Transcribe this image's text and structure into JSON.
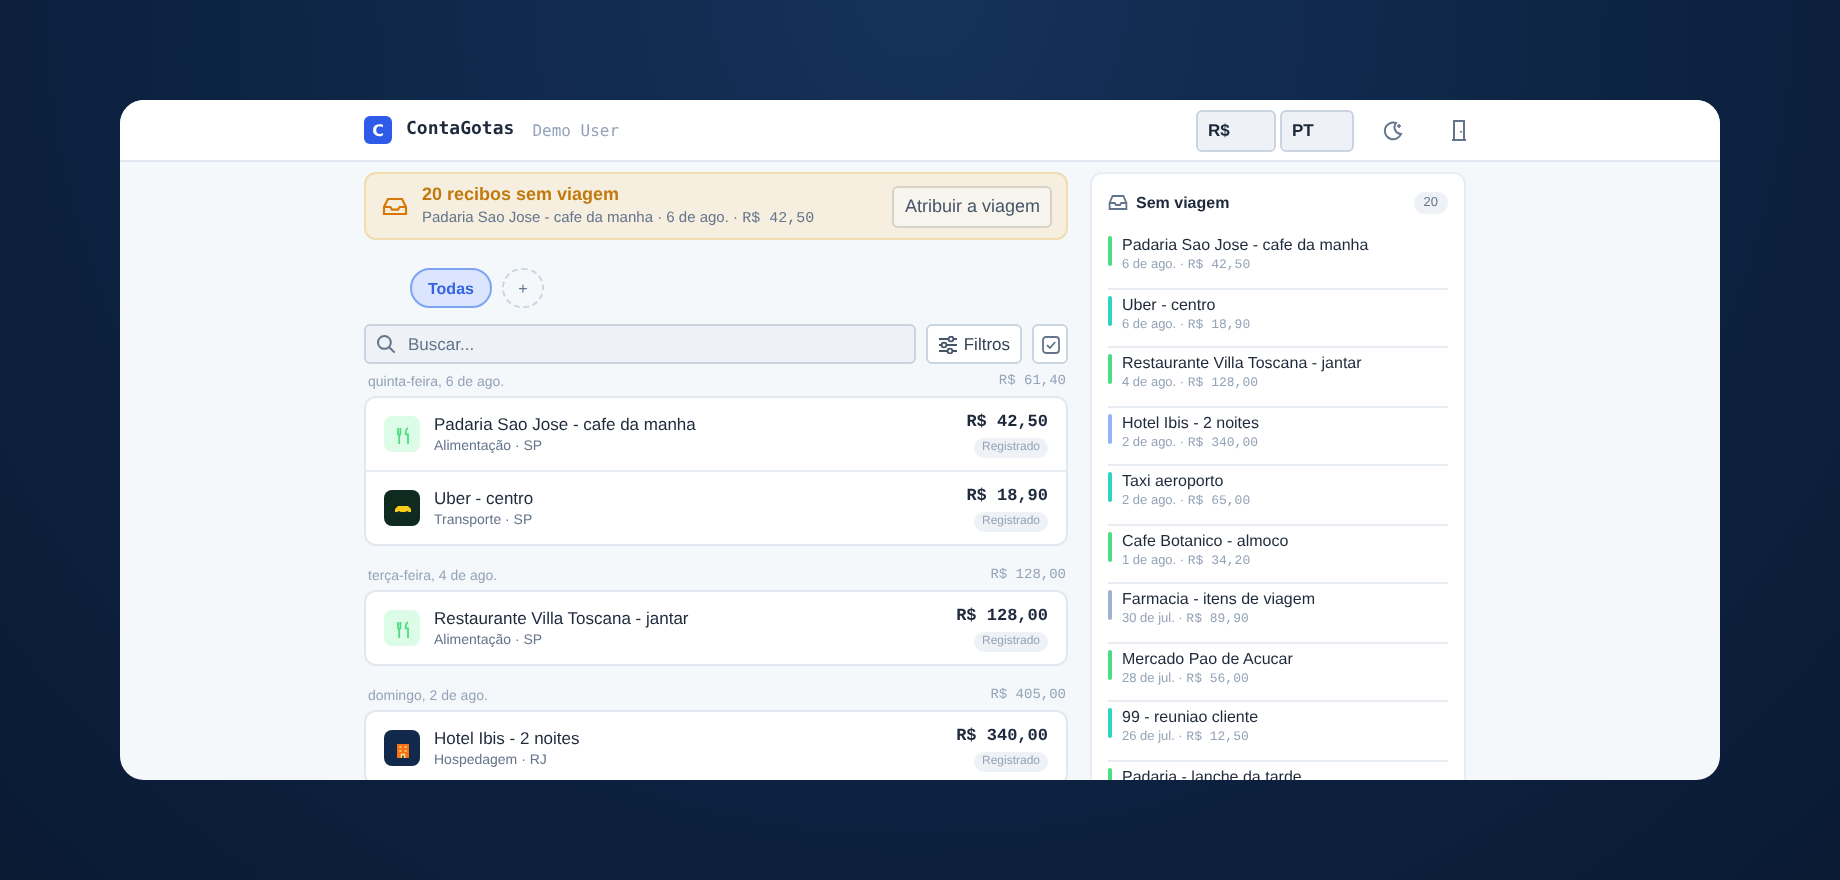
{
  "app": {
    "logo_letter": "C",
    "name": "ContaGotas",
    "user": "Demo User"
  },
  "header_controls": {
    "currency": "R$",
    "language": "PT"
  },
  "banner": {
    "title": "20 recibos sem viagem",
    "text": "Padaria Sao Jose - cafe da manha · 6 de ago. · ",
    "amount": "R$ 42,50",
    "button": "Atribuir a viagem"
  },
  "chips": [
    {
      "label": "Todas",
      "selected": true
    },
    {
      "label": "+",
      "selected": false
    }
  ],
  "search": {
    "placeholder": "Buscar...",
    "filter_button": "Filtros"
  },
  "groups": [
    {
      "date": "quinta-feira, 6 de ago.",
      "total": "R$ 61,40",
      "receipts": [
        {
          "kind": "food",
          "title": "Padaria Sao Jose - cafe da manha",
          "subtitle": "Alimentação · SP",
          "amount": "R$ 42,50",
          "status": "Registrado"
        },
        {
          "kind": "car",
          "title": "Uber - centro",
          "subtitle": "Transporte · SP",
          "amount": "R$ 18,90",
          "status": "Registrado"
        }
      ]
    },
    {
      "date": "terça-feira, 4 de ago.",
      "total": "R$ 128,00",
      "receipts": [
        {
          "kind": "food",
          "title": "Restaurante Villa Toscana - jantar",
          "subtitle": "Alimentação · SP",
          "amount": "R$ 128,00",
          "status": "Registrado"
        }
      ]
    },
    {
      "date": "domingo, 2 de ago.",
      "total": "R$ 405,00",
      "receipts": [
        {
          "kind": "hotel",
          "title": "Hotel Ibis - 2 noites",
          "subtitle": "Hospedagem · RJ",
          "amount": "R$ 340,00",
          "status": "Registrado"
        }
      ]
    }
  ],
  "side_panel": {
    "title": "Sem viagem",
    "count": "20",
    "items": [
      {
        "title": "Padaria Sao Jose - cafe da manha",
        "date": "6 de ago. · ",
        "amount": "R$ 42,50",
        "color": "#4ade80"
      },
      {
        "title": "Uber - centro",
        "date": "6 de ago. · ",
        "amount": "R$ 18,90",
        "color": "#2dd4bf"
      },
      {
        "title": "Restaurante Villa Toscana - jantar",
        "date": "4 de ago. · ",
        "amount": "R$ 128,00",
        "color": "#4ade80"
      },
      {
        "title": "Hotel Ibis - 2 noites",
        "date": "2 de ago. · ",
        "amount": "R$ 340,00",
        "color": "#93b4f8"
      },
      {
        "title": "Taxi aeroporto",
        "date": "2 de ago. · ",
        "amount": "R$ 65,00",
        "color": "#2dd4bf"
      },
      {
        "title": "Cafe Botanico - almoco",
        "date": "1 de ago. · ",
        "amount": "R$ 34,20",
        "color": "#4ade80"
      },
      {
        "title": "Farmacia - itens de viagem",
        "date": "30 de jul. · ",
        "amount": "R$ 89,90",
        "color": "#9fb0d0"
      },
      {
        "title": "Mercado Pao de Acucar",
        "date": "28 de jul. · ",
        "amount": "R$ 56,00",
        "color": "#4ade80"
      },
      {
        "title": "99 - reuniao cliente",
        "date": "26 de jul. · ",
        "amount": "R$ 12,50",
        "color": "#2dd4bf"
      },
      {
        "title": "Padaria - lanche da tarde",
        "color": "#4ade80"
      }
    ]
  }
}
